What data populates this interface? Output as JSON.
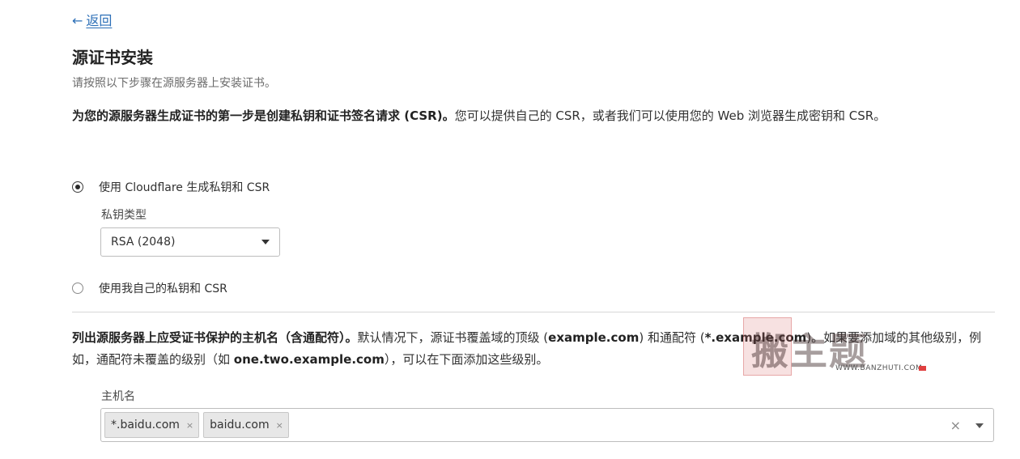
{
  "nav": {
    "back_arrow": "←",
    "back_label": "返回"
  },
  "header": {
    "title": "源证书安装",
    "subtitle": "请按照以下步骤在源服务器上安装证书。"
  },
  "intro": {
    "bold": "为您的源服务器生成证书的第一步是创建私钥和证书签名请求 (CSR)。",
    "rest": "您可以提供自己的 CSR，或者我们可以使用您的 Web 浏览器生成密钥和 CSR。"
  },
  "options": {
    "cloudflare": {
      "label": "使用 Cloudflare 生成私钥和 CSR",
      "checked": true
    },
    "own": {
      "label": "使用我自己的私钥和 CSR",
      "checked": false
    }
  },
  "key_type": {
    "label": "私钥类型",
    "selected": "RSA (2048)"
  },
  "hostnames_intro": {
    "bold": "列出源服务器上应受证书保护的主机名（含通配符）。",
    "t1": "默认情况下，源证书覆盖域的顶级 (",
    "b2": "example.com",
    "t2": ") 和通配符 (",
    "b3": "*.example.com",
    "t3": ")。如果要添加域的其他级别，例如，通配符未覆盖的级别（如 ",
    "b4": "one.two.example.com",
    "t4": "），可以在下面添加这些级别。"
  },
  "hostnames": {
    "label": "主机名",
    "tags": [
      "*.baidu.com",
      "baidu.com"
    ],
    "tag_remove": "×",
    "clear": "×"
  },
  "watermark": {
    "text": "搬主题",
    "url": "WWW.BANZHUTI.COM"
  },
  "icons": {
    "back": "arrow-left-icon",
    "select_caret": "caret-down-icon",
    "clear": "close-icon",
    "tag_remove": "close-icon"
  },
  "colors": {
    "link": "#2c6fb7",
    "border": "#bdbdbd",
    "tag_bg": "#e7e7e7"
  }
}
